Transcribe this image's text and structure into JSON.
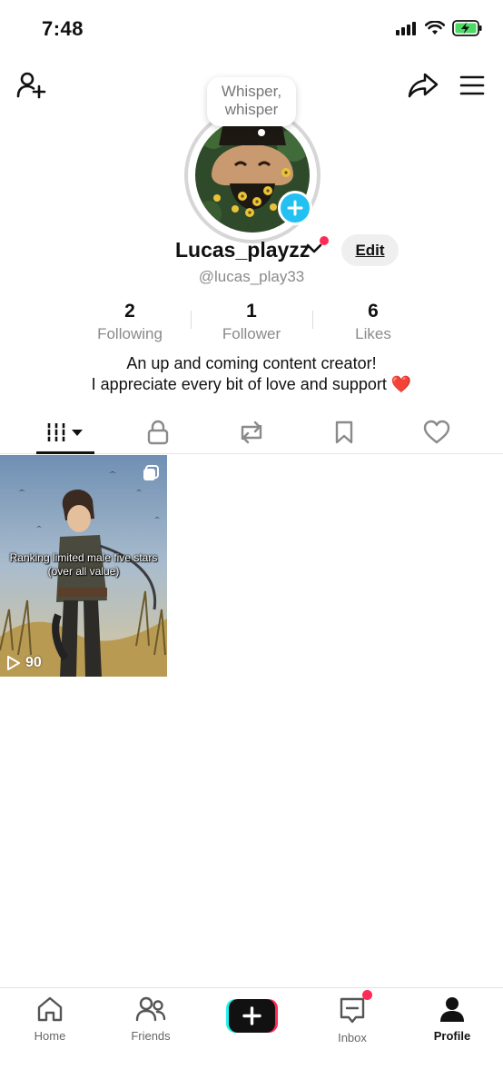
{
  "status_bar": {
    "time": "7:48"
  },
  "profile": {
    "bubble_text": "Whisper, whisper",
    "username": "Lucas_playzz",
    "handle": "@lucas_play33",
    "edit_label": "Edit",
    "bio_line1": "An up and coming content creator!",
    "bio_line2": "I appreciate every bit of love and support",
    "bio_emoji": "❤️"
  },
  "stats": [
    {
      "number": "2",
      "label": "Following"
    },
    {
      "number": "1",
      "label": "Follower"
    },
    {
      "number": "6",
      "label": "Likes"
    }
  ],
  "tabs": [
    {
      "icon": "grid-videos-icon",
      "active": true
    },
    {
      "icon": "lock-icon",
      "active": false
    },
    {
      "icon": "repost-icon",
      "active": false
    },
    {
      "icon": "bookmark-icon",
      "active": false
    },
    {
      "icon": "heart-icon",
      "active": false
    }
  ],
  "videos": [
    {
      "caption": "Ranking limited male five stars (over all value)",
      "views": "90"
    }
  ],
  "bottom_nav": [
    {
      "label": "Home",
      "icon": "home-icon"
    },
    {
      "label": "Friends",
      "icon": "friends-icon"
    },
    {
      "label": "",
      "icon": "plus-icon"
    },
    {
      "label": "Inbox",
      "icon": "inbox-icon"
    },
    {
      "label": "Profile",
      "icon": "profile-icon"
    }
  ],
  "colors": {
    "accent_red": "#fe2c55",
    "accent_cyan": "#22c1f1",
    "battery_green": "#4cd964"
  }
}
